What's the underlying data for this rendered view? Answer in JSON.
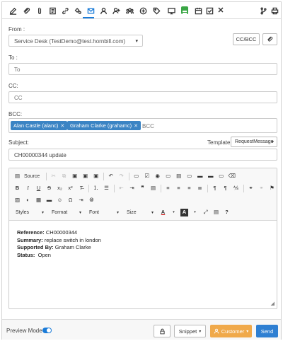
{
  "toolbar": {
    "icons": [
      "edit-icon",
      "paperclip-icon",
      "attach-icon",
      "document-icon",
      "link-icon",
      "gears-icon",
      "email-icon",
      "user-icon",
      "add-user-icon",
      "team-icon",
      "plus-circle-icon",
      "tag-icon",
      "monitor-icon",
      "board-icon",
      "calendar-icon",
      "checkbox-icon",
      "close-icon",
      "branch-icon",
      "print-icon"
    ],
    "active": "email-icon",
    "active_color": "#1a7bd8"
  },
  "form": {
    "from_label": "From :",
    "from_value": "Service Desk (TestDemo@test.hornbill.com)",
    "ccbcc_button": "CC/BCC",
    "to_label": "To :",
    "to_placeholder": "To",
    "cc_label": "CC:",
    "cc_placeholder": "CC",
    "bcc_label": "BCC:",
    "bcc_tags": [
      "Alan Castle (alanc)",
      "Graham Clarke (grahamc)"
    ],
    "bcc_placeholder": "BCC",
    "subject_label": "Subject:",
    "template_label": "Template",
    "template_value": "RequestMessage",
    "subject_value": "CH00000344 update"
  },
  "editor": {
    "source_label": "Source",
    "styles_label": "Styles",
    "format_label": "Format",
    "font_label": "Font",
    "size_label": "Size",
    "content": {
      "reference_label": "Reference:",
      "reference_value": "CH00000344",
      "summary_label": "Summary:",
      "summary_value": "replace switch in london",
      "supported_label": "Supported By:",
      "supported_value": "Graham Clarke",
      "status_label": "Status:",
      "status_value": "Open"
    }
  },
  "footer": {
    "preview_label": "Preview Mode",
    "preview_on": true,
    "snippet_label": "Snippet",
    "customer_label": "Customer",
    "send_label": "Send",
    "colors": {
      "customer": "#f0a94a",
      "send": "#2e7fd2",
      "tag": "#3b84c4"
    }
  }
}
